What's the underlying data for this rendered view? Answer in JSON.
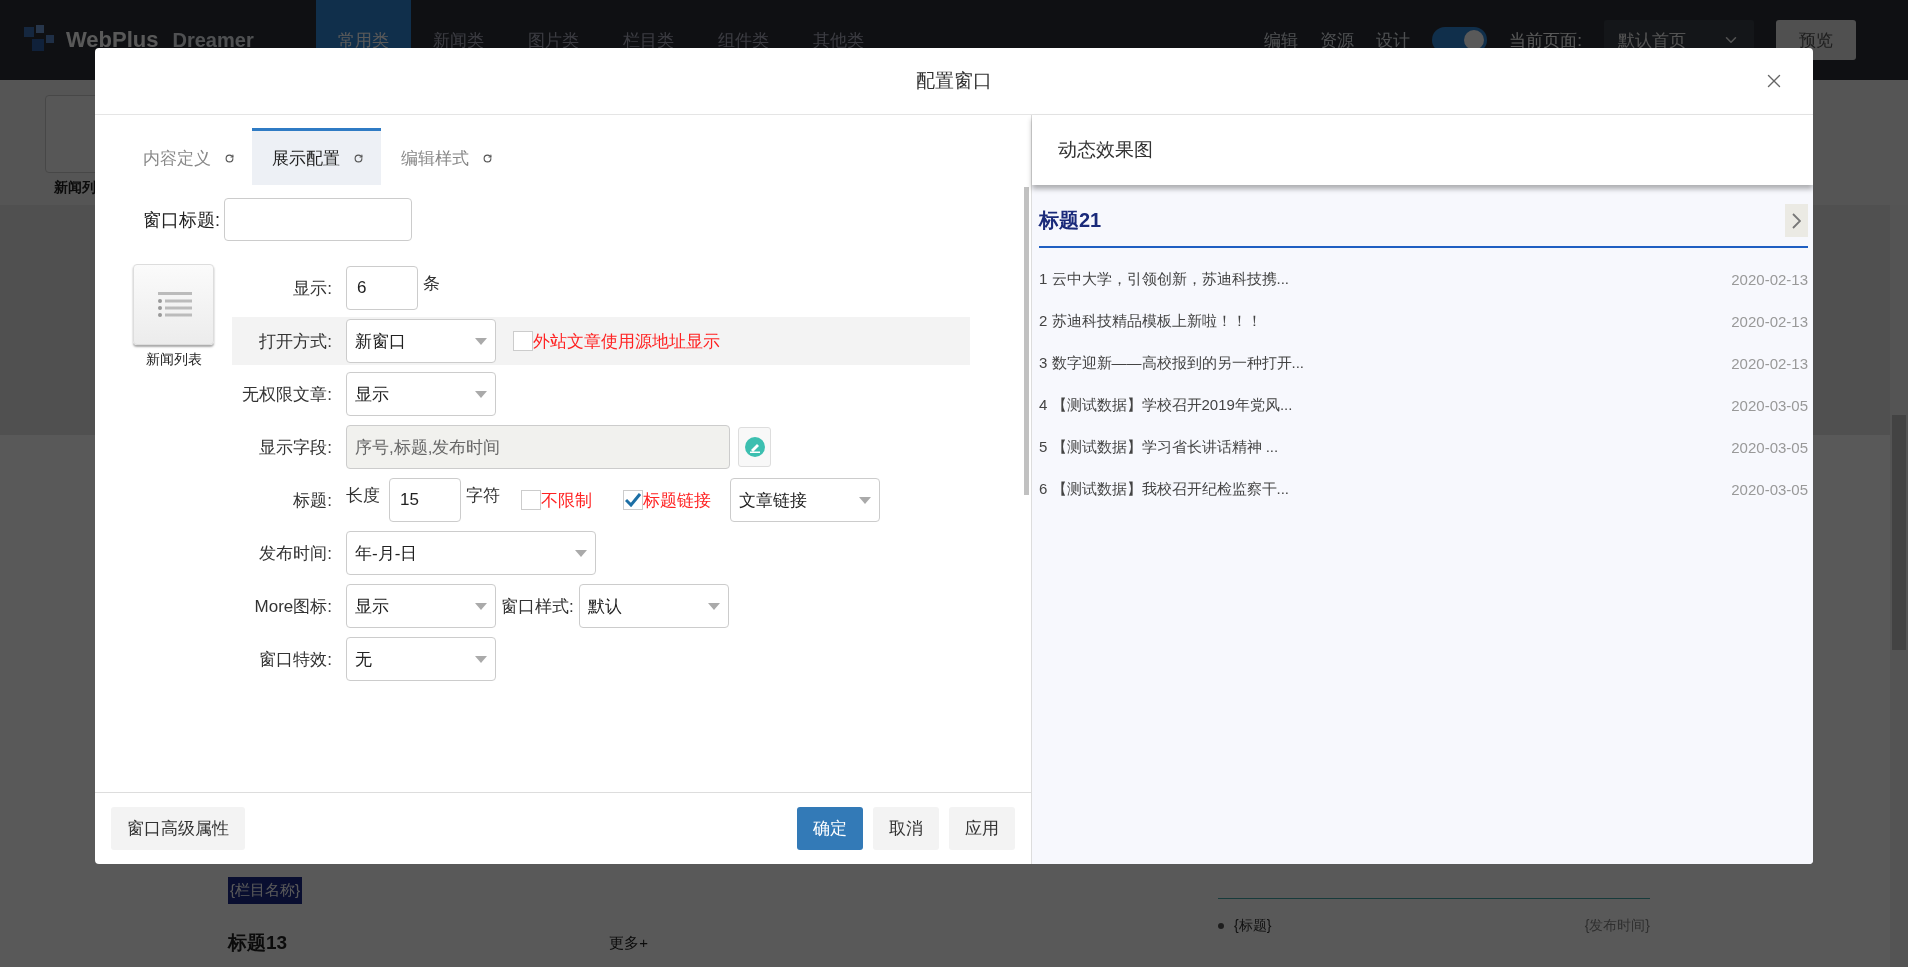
{
  "app": {
    "logo_primary": "WebPlus",
    "logo_secondary": "Dreamer",
    "nav_tabs": [
      {
        "label": "常用类",
        "selected": true
      },
      {
        "label": "新闻类",
        "selected": false
      },
      {
        "label": "图片类",
        "selected": false
      },
      {
        "label": "栏目类",
        "selected": false
      },
      {
        "label": "组件类",
        "selected": false
      },
      {
        "label": "其他类",
        "selected": false
      }
    ],
    "header_links": [
      "编辑",
      "资源",
      "设计"
    ],
    "mode_toggle": {
      "on": true
    },
    "current_page": {
      "label": "当前页面:",
      "value": "默认首页"
    },
    "preview_button": "预览",
    "palette": [
      {
        "label": "新闻列"
      }
    ],
    "canvas": {
      "column_badge": "{栏目名称}",
      "title": "标题13",
      "more": "更多+",
      "list_item": "{标题}",
      "list_date": "{发布时间}"
    }
  },
  "dialog": {
    "title": "配置窗口",
    "tabs": [
      {
        "label": "内容定义",
        "selected": false
      },
      {
        "label": "展示配置",
        "selected": true
      },
      {
        "label": "编辑样式",
        "selected": false
      }
    ],
    "window_title": {
      "label": "窗口标题:"
    },
    "widget": {
      "label": "新闻列表"
    },
    "rows": [
      {
        "label": "显示:",
        "shaded": false,
        "controls": [
          {
            "kind": "input",
            "value": "6"
          },
          {
            "kind": "text",
            "text": "条"
          }
        ]
      },
      {
        "label": "打开方式:",
        "shaded": true,
        "controls": [
          {
            "kind": "select",
            "value": "新窗口"
          },
          {
            "kind": "checkbox",
            "label": "外站文章使用源地址显示",
            "checked": false
          }
        ]
      },
      {
        "label": "无权限文章:",
        "shaded": false,
        "controls": [
          {
            "kind": "select",
            "value": "显示"
          }
        ]
      },
      {
        "label": "显示字段:",
        "shaded": false,
        "controls": [
          {
            "kind": "readonly",
            "value": "序号,标题,发布时间"
          },
          {
            "kind": "edit_button"
          }
        ]
      },
      {
        "label": "标题:",
        "shaded": false,
        "controls": [
          {
            "kind": "text",
            "text": "长度"
          },
          {
            "kind": "input",
            "value": "15"
          },
          {
            "kind": "text",
            "text": "字符"
          },
          {
            "kind": "checkbox",
            "label": "不限制",
            "checked": false
          },
          {
            "kind": "checkbox",
            "label": "标题链接",
            "checked": true
          },
          {
            "kind": "select",
            "value": "文章链接"
          }
        ]
      },
      {
        "label": "发布时间:",
        "shaded": false,
        "controls": [
          {
            "kind": "select_wide",
            "value": "年-月-日"
          }
        ]
      },
      {
        "label": "More图标:",
        "shaded": false,
        "controls": [
          {
            "kind": "select",
            "value": "显示"
          },
          {
            "kind": "label",
            "text": "窗口样式:"
          },
          {
            "kind": "select",
            "value": "默认"
          }
        ]
      },
      {
        "label": "窗口特效:",
        "shaded": false,
        "controls": [
          {
            "kind": "select",
            "value": "无"
          }
        ]
      }
    ],
    "footer": {
      "advanced_button": "窗口高级属性",
      "buttons": [
        {
          "label": "确定",
          "primary": true
        },
        {
          "label": "取消",
          "primary": false
        },
        {
          "label": "应用",
          "primary": false
        }
      ]
    },
    "preview": {
      "heading": "动态效果图",
      "box_title": "标题21",
      "items": [
        {
          "text": "1 云中大学，引领创新，苏迪科技携...",
          "date": "2020-02-13"
        },
        {
          "text": "2 苏迪科技精品模板上新啦！！！",
          "date": "2020-02-13"
        },
        {
          "text": "3 数字迎新——高校报到的另一种打开...",
          "date": "2020-02-13"
        },
        {
          "text": "4 【测试数据】学校召开2019年党风...",
          "date": "2020-03-05"
        },
        {
          "text": "5 【测试数据】学习省长讲话精神 ...",
          "date": "2020-03-05"
        },
        {
          "text": "6 【测试数据】我校召开纪检监察干...",
          "date": "2020-03-05"
        }
      ]
    }
  }
}
